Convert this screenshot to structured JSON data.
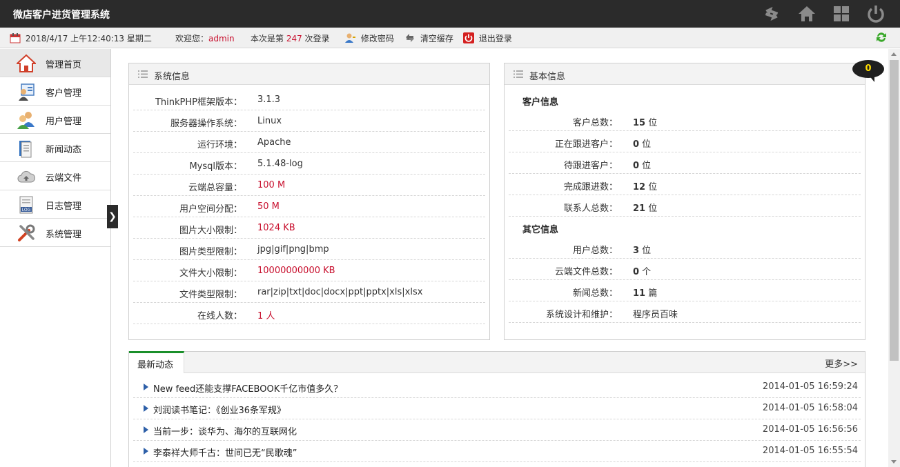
{
  "app": {
    "title": "微店客户进货管理系统"
  },
  "statusbar": {
    "datetime": "2018/4/17 上午12:40:13 星期二",
    "welcome_prefix": "欢迎您：",
    "username": "admin",
    "login_prefix": "本次是第 ",
    "login_count": "247",
    "login_suffix": " 次登录",
    "change_password": "修改密码",
    "clear_cache": "清空缓存",
    "logout": "退出登录"
  },
  "sidebar": {
    "items": [
      {
        "label": "管理首页",
        "icon": "home-icon"
      },
      {
        "label": "客户管理",
        "icon": "customer-icon"
      },
      {
        "label": "用户管理",
        "icon": "users-icon"
      },
      {
        "label": "新闻动态",
        "icon": "news-icon"
      },
      {
        "label": "云端文件",
        "icon": "cloud-icon"
      },
      {
        "label": "日志管理",
        "icon": "log-icon"
      },
      {
        "label": "系统管理",
        "icon": "tools-icon"
      }
    ],
    "toggle": "❯"
  },
  "badge": {
    "count": "0"
  },
  "sysinfo": {
    "title": "系统信息",
    "rows": [
      {
        "key": "ThinkPHP框架版本：",
        "value": "3.1.3"
      },
      {
        "key": "服务器操作系统：",
        "value": "Linux"
      },
      {
        "key": "运行环境：",
        "value": "Apache"
      },
      {
        "key": "Mysql版本：",
        "value": "5.1.48-log"
      },
      {
        "key": "云端总容量：",
        "value": "100 M"
      },
      {
        "key": "用户空间分配：",
        "value": "50 M"
      },
      {
        "key": "图片大小限制：",
        "value": "1024 KB"
      },
      {
        "key": "图片类型限制：",
        "value": "jpg|gif|png|bmp"
      },
      {
        "key": "文件大小限制：",
        "value": "10000000000 KB"
      },
      {
        "key": "文件类型限制：",
        "value": "rar|zip|txt|doc|docx|ppt|pptx|xls|xlsx"
      },
      {
        "key": "在线人数：",
        "value": "1 人"
      }
    ]
  },
  "basicinfo": {
    "title": "基本信息",
    "customer_section": "客户信息",
    "customer_rows": [
      {
        "key": "客户总数：",
        "num": "15",
        "unit": " 位"
      },
      {
        "key": "正在跟进客户：",
        "num": "0",
        "unit": " 位"
      },
      {
        "key": "待跟进客户：",
        "num": "0",
        "unit": " 位"
      },
      {
        "key": "完成跟进数：",
        "num": "12",
        "unit": " 位"
      },
      {
        "key": "联系人总数：",
        "num": "21",
        "unit": " 位"
      }
    ],
    "other_section": "其它信息",
    "other_rows": [
      {
        "key": "用户总数：",
        "num": "3",
        "unit": " 位"
      },
      {
        "key": "云端文件总数：",
        "num": "0",
        "unit": " 个"
      },
      {
        "key": "新闻总数：",
        "num": "11",
        "unit": " 篇"
      },
      {
        "key": "系统设计和维护：",
        "num": "",
        "unit": "程序员百味"
      }
    ]
  },
  "news": {
    "tab": "最新动态",
    "more": "更多>>",
    "items": [
      {
        "title": "New feed还能支撑FACEBOOK千亿市值多久？",
        "date": "2014-01-05 16:59:24"
      },
      {
        "title": "刘润读书笔记：《创业36条军规》",
        "date": "2014-01-05 16:58:04"
      },
      {
        "title": "当前一步：谈华为、海尔的互联网化",
        "date": "2014-01-05 16:56:56"
      },
      {
        "title": "李泰祥大师千古：世间已无“民歌魂”",
        "date": "2014-01-05 16:55:54"
      }
    ]
  },
  "colors": {
    "accent_red": "#c8102e",
    "tab_green": "#1a8f2a",
    "header_bg": "#2b2b2b"
  }
}
